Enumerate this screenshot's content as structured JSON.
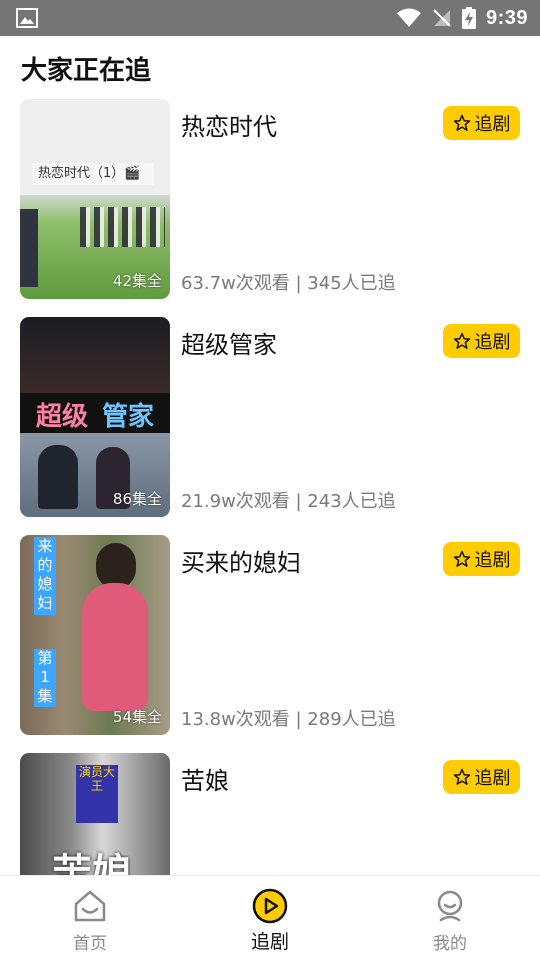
{
  "status_bar": {
    "time": "9:39"
  },
  "section": {
    "title": "大家正在追"
  },
  "dramas": [
    {
      "title": "热恋时代",
      "episodes": "42集全",
      "stats": "63.7w次观看 | 345人已追",
      "thumb_caption": "热恋时代（1）🎬",
      "follow_label": "追剧"
    },
    {
      "title": "超级管家",
      "episodes": "86集全",
      "stats": "21.9w次观看 | 243人已追",
      "thumb_caption_a": "超级",
      "thumb_caption_b": "管家",
      "follow_label": "追剧"
    },
    {
      "title": "买来的媳妇",
      "episodes": "54集全",
      "stats": "13.8w次观看 | 289人已追",
      "thumb_caption_a": "来的媳妇",
      "thumb_caption_b": "第1集",
      "follow_label": "追剧"
    },
    {
      "title": "苦娘",
      "episodes": "",
      "stats": "",
      "thumb_caption_a": "演员大王",
      "thumb_caption_b": "苦娘",
      "follow_label": "追剧"
    }
  ],
  "bottom_nav": [
    {
      "label": "首页",
      "icon": "home-icon",
      "active": false
    },
    {
      "label": "追剧",
      "icon": "play-circle-icon",
      "active": true
    },
    {
      "label": "我的",
      "icon": "profile-icon",
      "active": false
    }
  ],
  "colors": {
    "accent": "#FFCC00",
    "status_bar": "#757575",
    "muted_text": "#7a7a7a"
  }
}
